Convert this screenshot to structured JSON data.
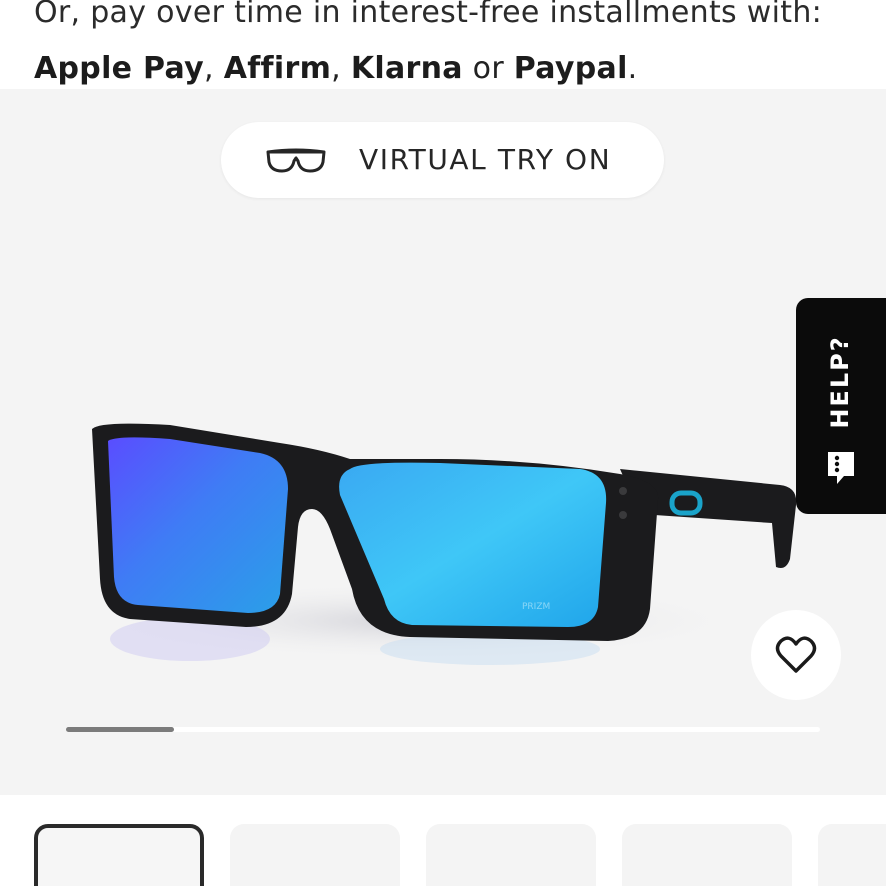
{
  "payment_note": {
    "line1": "Or, pay over time in interest-free installments with:",
    "methods": [
      "Apple Pay",
      "Affirm",
      "Klarna",
      "Paypal"
    ],
    "sep_comma": ", ",
    "sep_or": " or ",
    "end": "."
  },
  "gallery": {
    "virtual_try_on_label": "VIRTUAL TRY ON",
    "virtual_try_on_icon": "glasses-outline-icon",
    "product_image_alt": "Sunglasses with matte black frame and blue mirrored lenses",
    "lens_text": "PRIZM",
    "favorite_icon": "heart-outline-icon",
    "carousel_progress": 0.143
  },
  "help_tab": {
    "label": "HELP?",
    "icon": "chat-bubble-icon",
    "color": "#0b0b0b"
  },
  "thumbnails": {
    "count_visible": 5,
    "selected_index": 0
  },
  "colors": {
    "gallery_bg": "#f4f4f4",
    "lens_blue": "#3fb6f0",
    "frame": "#1b1b1d"
  }
}
